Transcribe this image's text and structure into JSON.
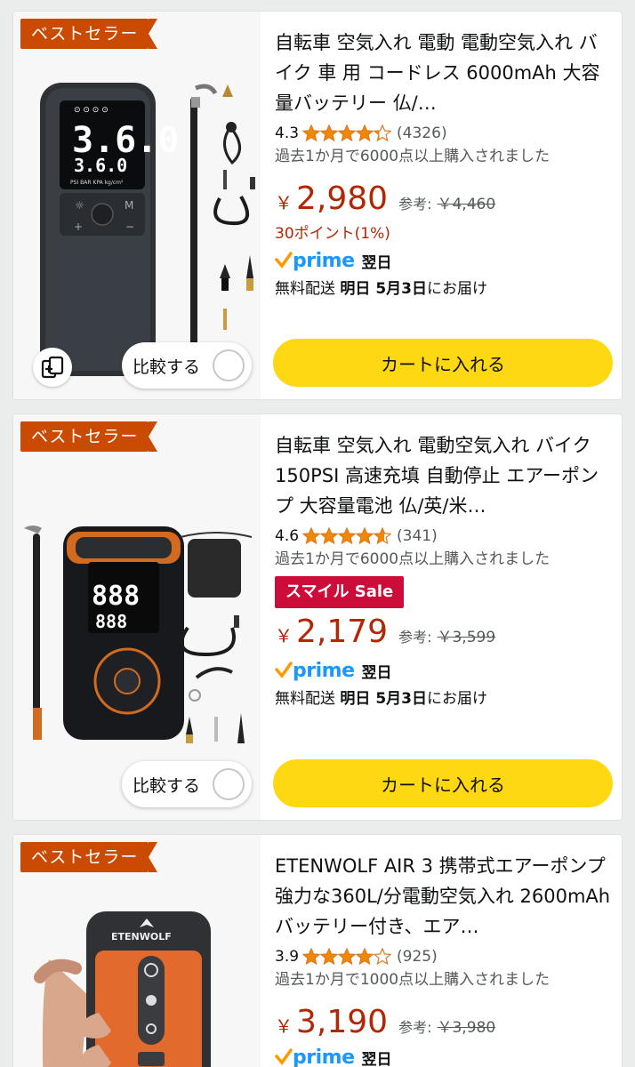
{
  "common": {
    "badge": "ベストセラー",
    "compare_label": "比較する",
    "cart_label": "カートに入れる",
    "ref_label": "参考:",
    "yen": "￥",
    "prime_word": "prime",
    "ship_prefix": "無料配送",
    "ship_day": "明日 5月3日",
    "ship_suffix": "にお届け"
  },
  "colors": {
    "badge": "#c94a00",
    "price": "#b12704",
    "cart": "#ffd814",
    "prime": "#1a98ff",
    "sale": "#cc0c39"
  },
  "products": [
    {
      "title": "自転車 空気入れ 電動 電動空気入れ バイク 車 用 コードレス 6000mAh 大容量バッテリー 仏/…",
      "rating": "4.3",
      "stars": 4.3,
      "reviews": "(4326)",
      "bought": "過去1か月で6000点以上購入されました",
      "price": "2,980",
      "ref_price": "￥4,460",
      "points": "30ポイント(1%)",
      "prime_delivery": "翌日"
    },
    {
      "title": "自転車 空気入れ 電動空気入れ バイク150PSI 高速充填 自動停止 エアーポンプ 大容量電池 仏/英/米…",
      "rating": "4.6",
      "stars": 4.6,
      "reviews": "(341)",
      "bought": "過去1か月で6000点以上購入されました",
      "sale": "スマイル Sale",
      "price": "2,179",
      "ref_price": "￥3,599",
      "prime_delivery": "翌日"
    },
    {
      "title": "ETENWOLF AIR 3 携帯式エアーポンプ 強力な360L/分電動空気入れ 2600mAhバッテリー付き、エア…",
      "rating": "3.9",
      "stars": 3.9,
      "reviews": "(925)",
      "bought": "過去1か月で1000点以上購入されました",
      "price": "3,190",
      "ref_price": "￥3,980",
      "prime_delivery": "翌日",
      "device_brand": "ETENWOLF"
    }
  ],
  "device1": {
    "display_main": "3.6.0",
    "display_sub": "3.6.0",
    "units": [
      "PSI",
      "BAR",
      "KPA",
      "kg/cm²"
    ]
  }
}
